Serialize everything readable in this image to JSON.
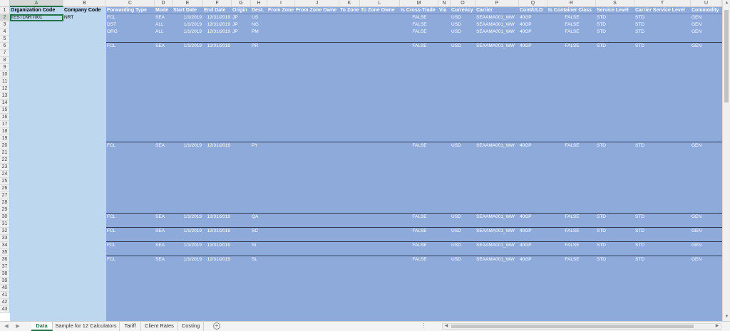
{
  "col_letters": [
    "A",
    "B",
    "C",
    "D",
    "E",
    "F",
    "G",
    "H",
    "I",
    "J",
    "K",
    "L",
    "M",
    "N",
    "O",
    "P",
    "Q",
    "R",
    "S",
    "T",
    "U"
  ],
  "selected_col": "A",
  "headers": {
    "A": "Organization Code",
    "B": "Company Code",
    "C": "Forwarding Type",
    "D": "Mode",
    "E": "Start Date",
    "F": "End Date",
    "G": "Origin",
    "H": "Dest.",
    "I": "From Zone",
    "J": "From Zone Owne",
    "K": "To Zone",
    "L": "To Zone Owne",
    "M": "Is Cross-Trade",
    "N": "Via",
    "O": "Currency",
    "P": "Carrier",
    "Q": "Cont/ULD",
    "R": "Is Container Class",
    "S": "Service Level",
    "T": "Carrier Service Level",
    "U": "Commodity"
  },
  "row_numbers": [
    "1",
    "2",
    "3",
    "4",
    "5",
    "6",
    "7",
    "8",
    "9",
    "10",
    "11",
    "12",
    "13",
    "14",
    "15",
    "16",
    "17",
    "18",
    "19",
    "20",
    "21",
    "22",
    "23",
    "24",
    "25",
    "26",
    "27",
    "28",
    "29",
    "30",
    "31",
    "32",
    "33",
    "34",
    "35",
    "36",
    "37",
    "38",
    "39",
    "40",
    "41",
    "42",
    "43"
  ],
  "selected_row": "2",
  "active_cell": "A2",
  "org_row": {
    "A": "TEST1NRT001",
    "B": "NRT"
  },
  "data_rows": [
    {
      "row": 2,
      "C": "FCL",
      "D": "SEA",
      "E": "1/1/2019",
      "F": "12/31/2019",
      "G": "JP",
      "H": "US",
      "M": "FALSE",
      "O": "USD",
      "P": "SEAAMA001_WW",
      "Q": "40GP",
      "R": "FALSE",
      "S": "STD",
      "T": "STD",
      "U": "GEN"
    },
    {
      "row": 3,
      "C": "DST",
      "D": "ALL",
      "E": "1/1/2019",
      "F": "12/31/2019",
      "G": "JP",
      "H": "NG",
      "M": "FALSE",
      "O": "USD",
      "P": "SEAAMA001_WW",
      "Q": "40GP",
      "R": "FALSE",
      "S": "STD",
      "T": "STD",
      "U": "GEN"
    },
    {
      "row": 4,
      "C": "ORG",
      "D": "ALL",
      "E": "1/1/2019",
      "F": "12/31/2019",
      "G": "JP",
      "H": "PM",
      "M": "FALSE",
      "O": "USD",
      "P": "SEAAMA001_WW",
      "Q": "40GP",
      "R": "FALSE",
      "S": "STD",
      "T": "STD",
      "U": "GEN"
    },
    {
      "row": 6,
      "C": "FCL",
      "D": "SEA",
      "E": "1/1/2019",
      "F": "12/31/2019",
      "G": "",
      "H": "PR",
      "M": "FALSE",
      "O": "USD",
      "P": "SEAAMA001_WW",
      "Q": "40GP",
      "R": "FALSE",
      "S": "STD",
      "T": "STD",
      "U": "GEN"
    },
    {
      "row": 20,
      "C": "FCL",
      "D": "SEA",
      "E": "1/1/2019",
      "F": "12/31/2019",
      "G": "",
      "H": "PY",
      "M": "FALSE",
      "O": "USD",
      "P": "SEAAMA001_WW",
      "Q": "40GP",
      "R": "FALSE",
      "S": "STD",
      "T": "STD",
      "U": "GEN"
    },
    {
      "row": 30,
      "C": "FCL",
      "D": "SEA",
      "E": "1/1/2019",
      "F": "12/31/2019",
      "G": "",
      "H": "QA",
      "M": "FALSE",
      "O": "USD",
      "P": "SEAAMA001_WW",
      "Q": "40GP",
      "R": "FALSE",
      "S": "STD",
      "T": "STD",
      "U": "GEN"
    },
    {
      "row": 32,
      "C": "FCL",
      "D": "SEA",
      "E": "1/1/2019",
      "F": "12/31/2019",
      "G": "",
      "H": "SC",
      "M": "FALSE",
      "O": "USD",
      "P": "SEAAMA001_WW",
      "Q": "40GP",
      "R": "FALSE",
      "S": "STD",
      "T": "STD",
      "U": "GEN"
    },
    {
      "row": 34,
      "C": "FCL",
      "D": "SEA",
      "E": "1/1/2019",
      "F": "12/31/2019",
      "G": "",
      "H": "SI",
      "M": "FALSE",
      "O": "USD",
      "P": "SEAAMA001_WW",
      "Q": "40GP",
      "R": "FALSE",
      "S": "STD",
      "T": "STD",
      "U": "GEN"
    },
    {
      "row": 36,
      "C": "FCL",
      "D": "SEA",
      "E": "1/1/2019",
      "F": "12/31/2019",
      "G": "",
      "H": "SL",
      "M": "FALSE",
      "O": "USD",
      "P": "SEAAMA001_WW",
      "Q": "40GP",
      "R": "FALSE",
      "S": "STD",
      "T": "STD",
      "U": "GEN"
    }
  ],
  "group_separator_rows": [
    5,
    19,
    29,
    31,
    33,
    35
  ],
  "sheet_tabs": [
    "Data",
    "Sample for 12 Calculators",
    "Tariff",
    "Client Rates",
    "Costing"
  ],
  "active_tab": "Data",
  "add_sheet_symbol": "+",
  "scroll_dots": "⋮",
  "colors": {
    "org_fill": "#bdd7ee",
    "data_fill": "#8eaadb",
    "excel_green": "#217346",
    "separator": "#2f3b52"
  },
  "icons": {
    "prev_sheet": "chevron-left-icon",
    "next_sheet": "chevron-right-icon",
    "add_sheet": "plus-circle-icon"
  }
}
